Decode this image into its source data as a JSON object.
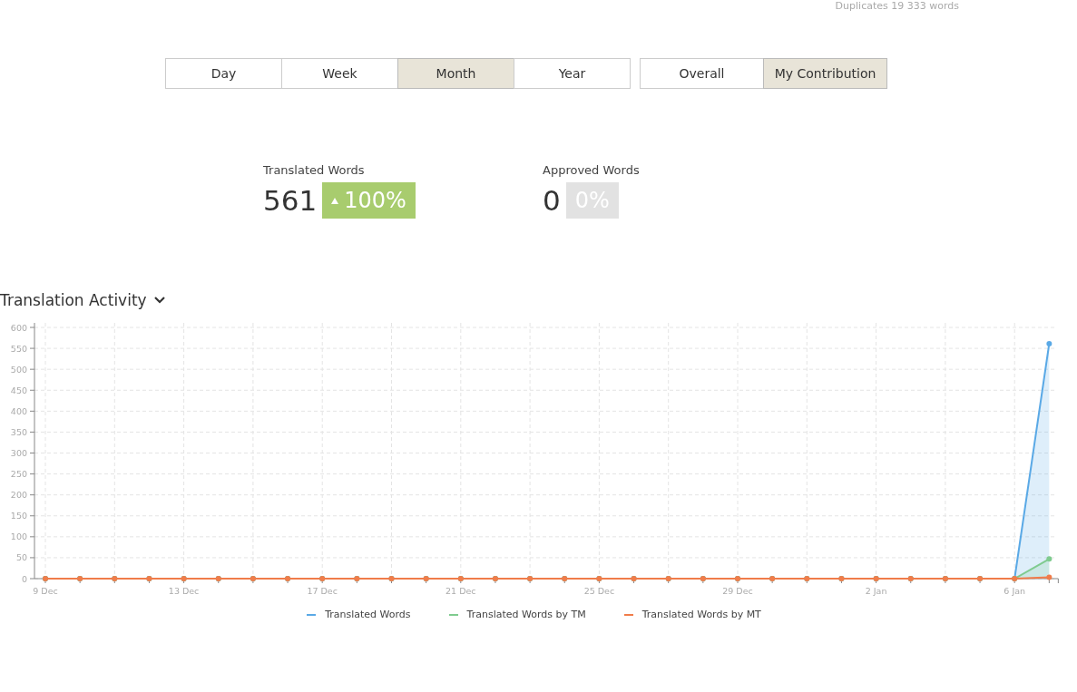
{
  "top_note": "Duplicates 19 333 words",
  "period_tabs": [
    {
      "label": "Day",
      "selected": false
    },
    {
      "label": "Week",
      "selected": false
    },
    {
      "label": "Month",
      "selected": true
    },
    {
      "label": "Year",
      "selected": false
    }
  ],
  "scope_tabs": [
    {
      "label": "Overall",
      "selected": false
    },
    {
      "label": "My Contribution",
      "selected": true
    }
  ],
  "stats": [
    {
      "label": "Translated Words",
      "value": "561",
      "change": "100%",
      "rising": true
    },
    {
      "label": "Approved Words",
      "value": "0",
      "change": "0%",
      "rising": false
    }
  ],
  "activity": {
    "title": "Translation Activity",
    "chart_data": {
      "type": "area",
      "categories": [
        "9 Dec",
        null,
        null,
        null,
        "13 Dec",
        null,
        null,
        null,
        "17 Dec",
        null,
        null,
        null,
        "21 Dec",
        null,
        null,
        null,
        "25 Dec",
        null,
        null,
        null,
        "29 Dec",
        null,
        null,
        null,
        "2 Jan",
        null,
        null,
        null,
        "6 Jan",
        null
      ],
      "grid": true,
      "ylim": [
        0,
        600
      ],
      "yticks": [
        0,
        50,
        100,
        150,
        200,
        250,
        300,
        350,
        400,
        450,
        500,
        550,
        600
      ],
      "series": [
        {
          "name": "Translated Words",
          "color": "#5aa9e6",
          "values": [
            0,
            0,
            0,
            0,
            0,
            0,
            0,
            0,
            0,
            0,
            0,
            0,
            0,
            0,
            0,
            0,
            0,
            0,
            0,
            0,
            0,
            0,
            0,
            0,
            0,
            0,
            0,
            0,
            0,
            561
          ]
        },
        {
          "name": "Translated Words by TM",
          "color": "#7fcb8f",
          "values": [
            0,
            0,
            0,
            0,
            0,
            0,
            0,
            0,
            0,
            0,
            0,
            0,
            0,
            0,
            0,
            0,
            0,
            0,
            0,
            0,
            0,
            0,
            0,
            0,
            0,
            0,
            0,
            0,
            0,
            47
          ]
        },
        {
          "name": "Translated Words by MT",
          "color": "#f07c4a",
          "values": [
            0,
            0,
            0,
            0,
            0,
            0,
            0,
            0,
            0,
            0,
            0,
            0,
            0,
            0,
            0,
            0,
            0,
            0,
            0,
            0,
            0,
            0,
            0,
            0,
            0,
            0,
            0,
            0,
            0,
            3
          ]
        }
      ]
    }
  }
}
